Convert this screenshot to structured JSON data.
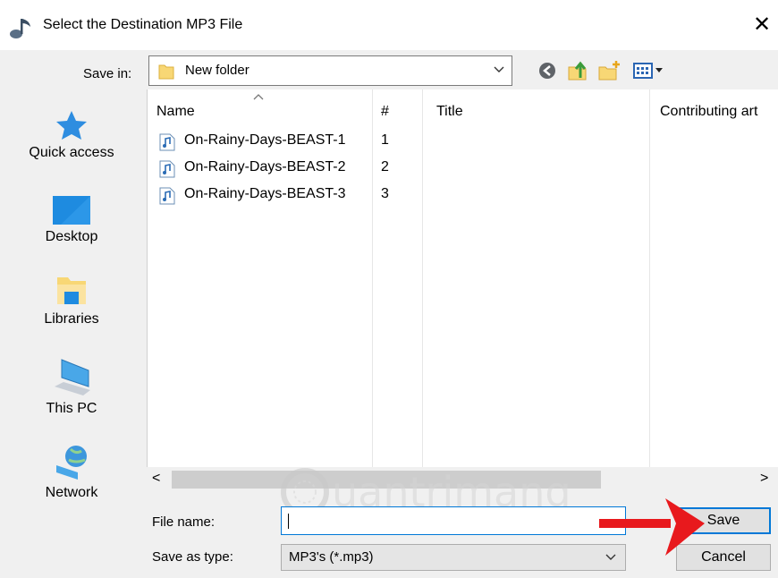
{
  "window": {
    "title": "Select the Destination MP3 File",
    "close_glyph": "✕"
  },
  "save_in": {
    "label": "Save in:",
    "folder": "New folder"
  },
  "toolbar": {
    "icons": [
      "back-icon",
      "up-folder-icon",
      "new-folder-icon",
      "view-menu-icon"
    ]
  },
  "places": [
    {
      "label": "Quick access",
      "icon": "star-icon"
    },
    {
      "label": "Desktop",
      "icon": "desktop-icon"
    },
    {
      "label": "Libraries",
      "icon": "libraries-icon"
    },
    {
      "label": "This PC",
      "icon": "computer-icon"
    },
    {
      "label": "Network",
      "icon": "network-icon"
    }
  ],
  "columns": [
    "Name",
    "#",
    "Title",
    "Contributing art"
  ],
  "files": [
    {
      "name": "On-Rainy-Days-BEAST-1",
      "num": "1"
    },
    {
      "name": "On-Rainy-Days-BEAST-2",
      "num": "2"
    },
    {
      "name": "On-Rainy-Days-BEAST-3",
      "num": "3"
    }
  ],
  "file_name": {
    "label": "File name:",
    "value": ""
  },
  "save_as_type": {
    "label": "Save as type:",
    "value": "MP3's (*.mp3)"
  },
  "buttons": {
    "save": "Save",
    "cancel": "Cancel"
  },
  "watermark": {
    "text": "uantrimang"
  },
  "colors": {
    "accent": "#0078d7",
    "arrow": "#e8191d",
    "folder": "#f8d775"
  }
}
